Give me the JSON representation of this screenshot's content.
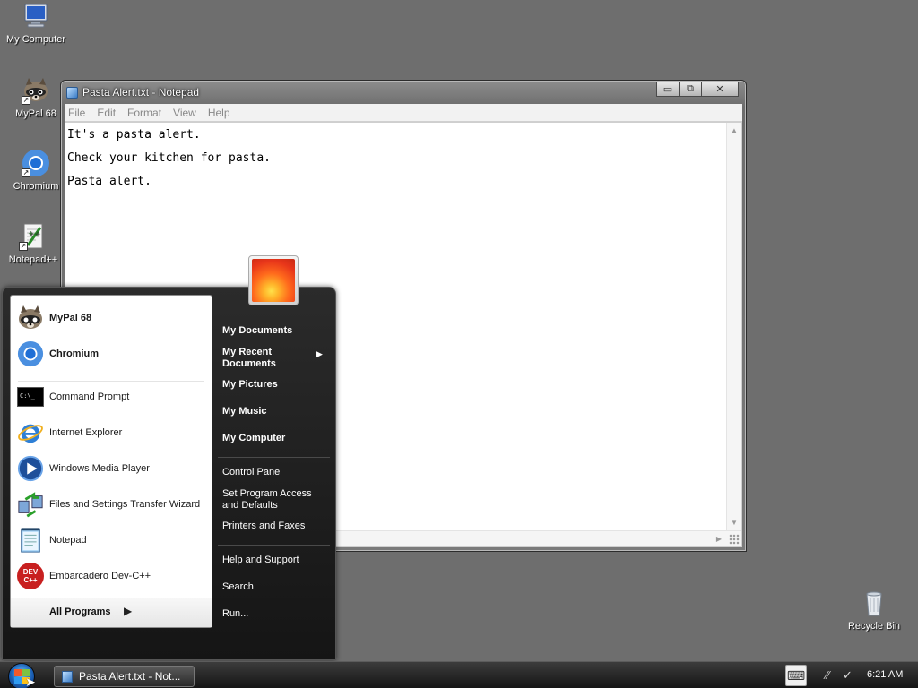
{
  "desktop": {
    "icons": [
      {
        "label": "My Computer"
      },
      {
        "label": "MyPal 68"
      },
      {
        "label": "Chromium"
      },
      {
        "label": "Notepad++"
      },
      {
        "label": "Recycle Bin"
      }
    ]
  },
  "notepad": {
    "title": "Pasta Alert.txt - Notepad",
    "menu": [
      "File",
      "Edit",
      "Format",
      "View",
      "Help"
    ],
    "lines": [
      "It's a pasta alert.",
      "Check your kitchen for pasta.",
      "Pasta alert."
    ],
    "buttons": {
      "minimize": "▭",
      "maximize": "⧉",
      "close": "✕"
    }
  },
  "start_menu": {
    "pinned": [
      {
        "label": "MyPal 68",
        "icon": "raccoon-icon"
      },
      {
        "label": "Chromium",
        "icon": "chromium-icon"
      }
    ],
    "recent": [
      {
        "label": "Command Prompt",
        "icon": "cmd-icon"
      },
      {
        "label": "Internet Explorer",
        "icon": "ie-icon"
      },
      {
        "label": "Windows Media Player",
        "icon": "wmp-icon"
      },
      {
        "label": "Files and Settings Transfer Wizard",
        "icon": "transfer-icon"
      },
      {
        "label": "Notepad",
        "icon": "notepad-icon"
      },
      {
        "label": "Embarcadero Dev-C++",
        "icon": "devcpp-icon"
      }
    ],
    "all_programs": "All Programs",
    "right_items": [
      "My Documents",
      "My Recent Documents",
      "My Pictures",
      "My Music",
      "My Computer",
      "Control Panel",
      "Set Program Access and Defaults",
      "Printers and Faxes",
      "Help and Support",
      "Search",
      "Run..."
    ],
    "right_items_display": {
      "recent_docs_line1": "My Recent",
      "recent_docs_line2": "Documents",
      "spad_line1": "Set Program Access",
      "spad_line2": "and Defaults"
    },
    "cmd_glyph": "C:\\_",
    "devcpp_glyph": "DEV C++"
  },
  "taskbar": {
    "task": "Pasta Alert.txt - Not...",
    "clock": "6:21 AM"
  }
}
